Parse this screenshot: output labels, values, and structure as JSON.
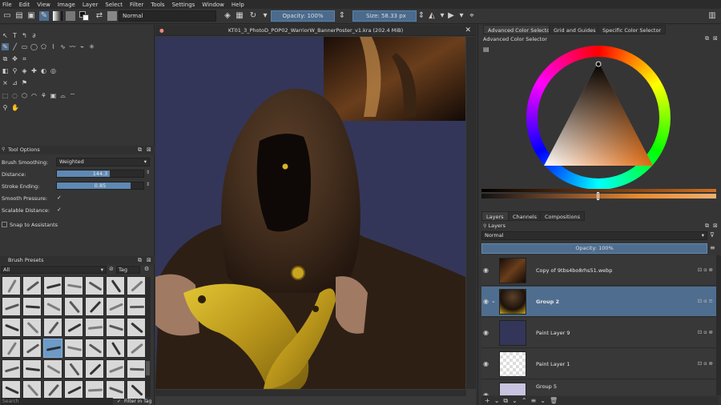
{
  "menu": [
    "File",
    "Edit",
    "View",
    "Image",
    "Layer",
    "Select",
    "Filter",
    "Tools",
    "Settings",
    "Window",
    "Help"
  ],
  "toolbar": {
    "blend_mode": "Normal",
    "opacity": "Opacity: 100%",
    "size_label": "Size:",
    "size_value": "58.33 px"
  },
  "document": {
    "title": "KT01_3_PhotoD_POP02_WarriorW_BannerPoster_v1.kra (202.4 MiB)"
  },
  "tool_options": {
    "title": "Tool Options",
    "brush_smoothing_label": "Brush Smoothing:",
    "brush_smoothing_value": "Weighted",
    "distance_label": "Distance:",
    "distance_value": "144.3",
    "distance_fill": 0.61,
    "stroke_ending_label": "Stroke Ending:",
    "stroke_ending_value": "0.85",
    "stroke_ending_fill": 0.85,
    "smooth_pressure_label": "Smooth Pressure:",
    "scalable_distance_label": "Scalable Distance:",
    "snap_label": "Snap to Assistants"
  },
  "brush_presets": {
    "title": "Brush Presets",
    "filter_value": "All",
    "tag_label": "Tag",
    "search_placeholder": "Search",
    "filter_in_tag_label": "Filter in Tag"
  },
  "right_tabs": [
    "Advanced Color Selector",
    "Grid and Guides",
    "Specific Color Selector"
  ],
  "color_selector_title": "Advanced Color Selector",
  "layer_tabs": [
    "Layers",
    "Channels",
    "Compositions"
  ],
  "layers_panel": {
    "title": "Layers",
    "blend_mode": "Normal",
    "opacity": "Opacity:  100%",
    "layers": [
      {
        "name": "Copy of 9tbs4bo8rhs51.webp",
        "selected": false
      },
      {
        "name": "Group 2",
        "selected": true
      },
      {
        "name": "Paint Layer 9",
        "selected": false
      },
      {
        "name": "Paint Layer 1",
        "selected": false
      },
      {
        "name": "Group 5",
        "selected": false
      }
    ]
  },
  "colors": {
    "accent_blue": "#4f6e8f",
    "canvas_bg": "#333659",
    "cloak_brown": "#4a3322",
    "gauntlet_gold": "#c9a81f"
  }
}
